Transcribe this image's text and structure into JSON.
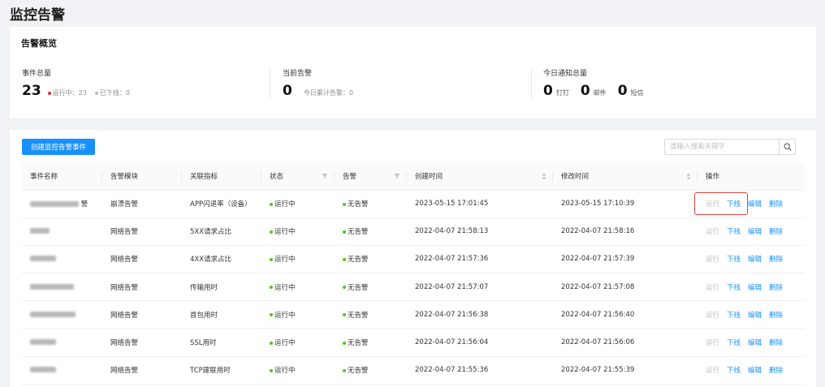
{
  "page": {
    "title": "监控告警"
  },
  "overview": {
    "title": "告警概览",
    "total_events": {
      "label": "事件总量",
      "value": "23",
      "running_label": "运行中：23",
      "offline_label": "已下线：0"
    },
    "current_alerts": {
      "label": "当前告警",
      "value": "0",
      "today_label": "今日累计告警：0"
    },
    "notifications": {
      "label": "今日通知总量",
      "channels": [
        {
          "value": "0",
          "unit": "钉钉"
        },
        {
          "value": "0",
          "unit": "邮件"
        },
        {
          "value": "0",
          "unit": "短信"
        }
      ]
    }
  },
  "toolbar": {
    "create_label": "创建监控告警事件",
    "search_placeholder": "请输入搜索关键字"
  },
  "table": {
    "columns": [
      "事件名称",
      "告警模块",
      "关联指标",
      "状态",
      "告警",
      "创建时间",
      "修改时间",
      "操作"
    ],
    "rows": [
      {
        "module": "崩溃告警",
        "metric": "APP闪退率（设备）",
        "status": "运行中",
        "alert": "无告警",
        "created": "2023-05-15 17:01:45",
        "modified": "2023-05-15 17:10:39"
      },
      {
        "module": "网络告警",
        "metric": "5XX请求占比",
        "status": "运行中",
        "alert": "无告警",
        "created": "2022-04-07 21:58:13",
        "modified": "2022-04-07 21:58:16"
      },
      {
        "module": "网络告警",
        "metric": "4XX请求占比",
        "status": "运行中",
        "alert": "无告警",
        "created": "2022-04-07 21:57:36",
        "modified": "2022-04-07 21:57:39"
      },
      {
        "module": "网络告警",
        "metric": "传输用时",
        "status": "运行中",
        "alert": "无告警",
        "created": "2022-04-07 21:57:07",
        "modified": "2022-04-07 21:57:08"
      },
      {
        "module": "网络告警",
        "metric": "首包用时",
        "status": "运行中",
        "alert": "无告警",
        "created": "2022-04-07 21:56:38",
        "modified": "2022-04-07 21:56:40"
      },
      {
        "module": "网络告警",
        "metric": "SSL用时",
        "status": "运行中",
        "alert": "无告警",
        "created": "2022-04-07 21:56:04",
        "modified": "2022-04-07 21:56:06"
      },
      {
        "module": "网络告警",
        "metric": "TCP建联用时",
        "status": "运行中",
        "alert": "无告警",
        "created": "2022-04-07 21:55:36",
        "modified": "2022-04-07 21:55:39"
      }
    ],
    "actions": {
      "run": "运行",
      "offline": "下线",
      "edit": "编辑",
      "delete": "删除"
    }
  },
  "colors": {
    "primary": "#1890ff",
    "running_dot": "#52c41a",
    "highlight": "#e0433d"
  }
}
